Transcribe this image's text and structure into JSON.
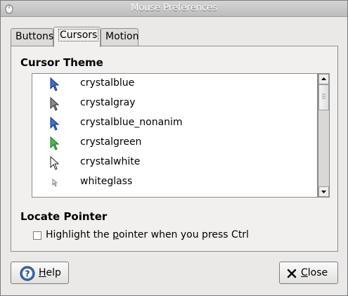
{
  "window": {
    "title": "Mouse Preferences"
  },
  "tabs": [
    {
      "label": "Buttons",
      "active": false
    },
    {
      "label": "Cursors",
      "active": true
    },
    {
      "label": "Motion",
      "active": false
    }
  ],
  "cursor_theme": {
    "heading": "Cursor Theme",
    "themes": [
      {
        "name": "crystalblue",
        "icon": "blue-arrow-cursor-icon",
        "color": "#3b6fe0"
      },
      {
        "name": "crystalgray",
        "icon": "gray-arrow-cursor-icon",
        "color": "#8a8a8a"
      },
      {
        "name": "crystalblue_nonanim",
        "icon": "blue-arrow-cursor-icon",
        "color": "#3b6fe0"
      },
      {
        "name": "crystalgreen",
        "icon": "green-arrow-cursor-icon",
        "color": "#43c04a"
      },
      {
        "name": "crystalwhite",
        "icon": "white-arrow-cursor-icon",
        "color": "#ffffff"
      },
      {
        "name": "whiteglass",
        "icon": "small-white-arrow-cursor-icon",
        "color": "#f2f2f2"
      },
      {
        "name": "",
        "icon": "partial-arrow-cursor-icon",
        "color": "#dddddd"
      }
    ]
  },
  "locate_pointer": {
    "heading": "Locate Pointer",
    "checkbox_label_pre": "Highlight the ",
    "checkbox_label_mnemonic": "p",
    "checkbox_label_post": "ointer when you press Ctrl",
    "checked": false
  },
  "buttons": {
    "help_mnemonic": "H",
    "help_rest": "elp",
    "close_mnemonic": "C",
    "close_rest": "lose"
  }
}
